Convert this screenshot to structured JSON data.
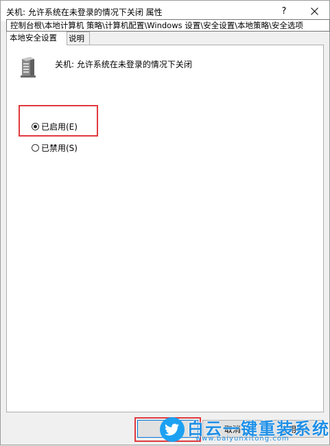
{
  "window": {
    "title": "关机: 允许系统在未登录的情况下关闭 属性",
    "help_label": "?"
  },
  "tooltip": {
    "path": "控制台根\\本地计算机 策略\\计算机配置\\Windows 设置\\安全设置\\本地策略\\安全选项"
  },
  "tabs": [
    {
      "label": "本地安全设置",
      "selected": true
    },
    {
      "label": "说明",
      "selected": false
    }
  ],
  "panel": {
    "policy_title": "关机: 允许系统在未登录的情况下关闭",
    "options": [
      {
        "label": "已启用(E)",
        "checked": true
      },
      {
        "label": "已禁用(S)",
        "checked": false
      }
    ]
  },
  "buttons": {
    "ok": "",
    "cancel": "取消",
    "apply": "应用(A)"
  },
  "watermark": {
    "title": "白云一键重装系统",
    "url": "www.baiyunxitong.com"
  },
  "colors": {
    "highlight": "#e0393e",
    "watermark": "#1e8fe6",
    "focus": "#0078d7"
  }
}
